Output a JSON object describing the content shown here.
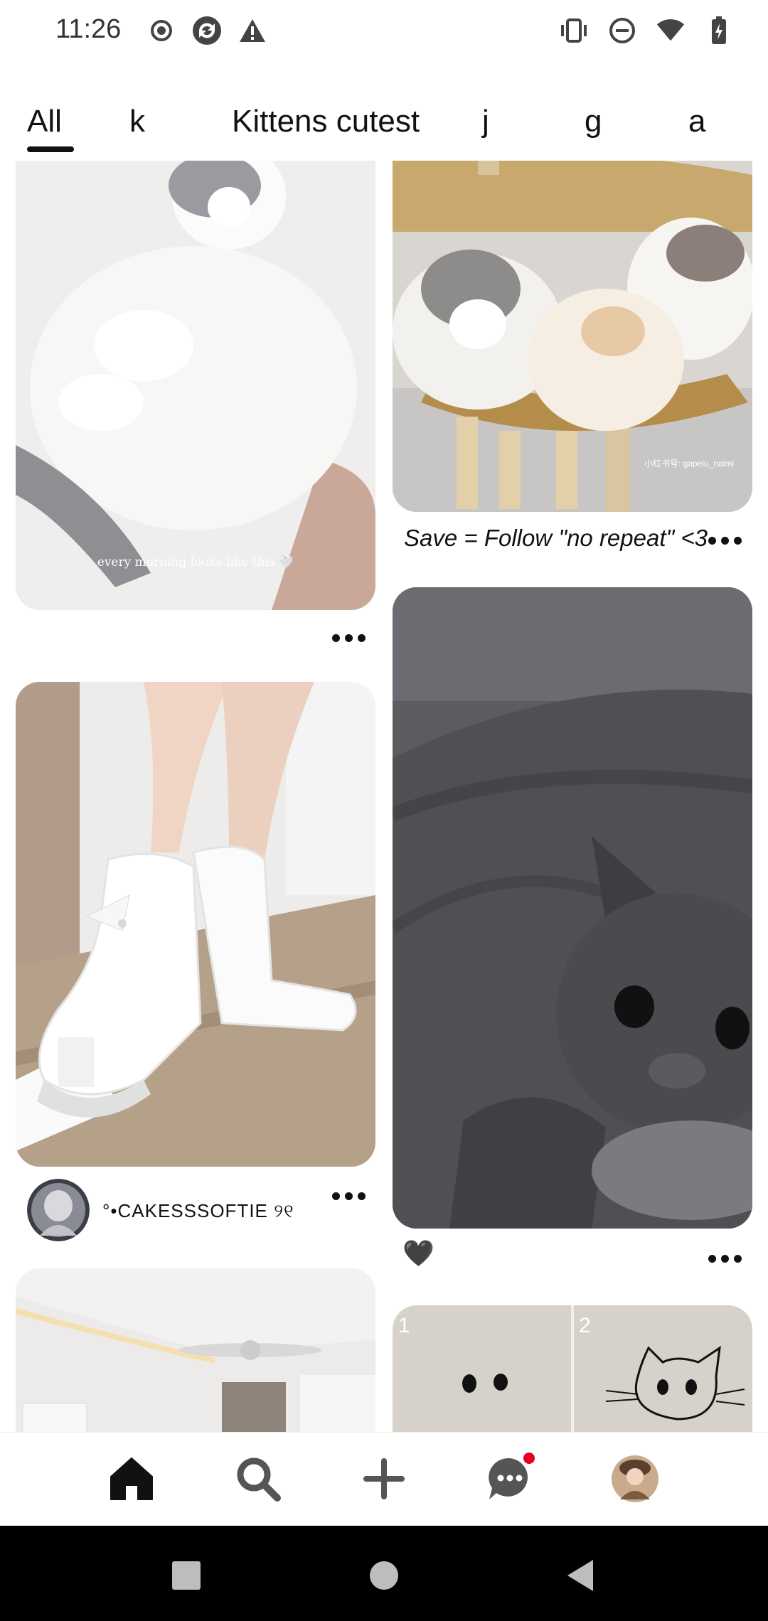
{
  "status_bar": {
    "time": "11:26",
    "left_icons": [
      "record-icon",
      "sync-app-icon",
      "warning-icon"
    ],
    "right_icons": [
      "vibrate-icon",
      "do-not-disturb-icon",
      "wifi-icon",
      "battery-icon"
    ]
  },
  "tabs": [
    {
      "label": "All",
      "selected": true
    },
    {
      "label": "k",
      "selected": false
    },
    {
      "label": "Kittens cutest",
      "selected": false
    },
    {
      "label": "j",
      "selected": false
    },
    {
      "label": "g",
      "selected": false
    },
    {
      "label": "a",
      "selected": false
    }
  ],
  "feed": {
    "pin1": {
      "image_overlay_text": "every morning looks like this 🤍"
    },
    "pin2": {
      "watermark": "小红书号: gapelu_naimi",
      "caption": "Save = Follow \"no repeat\" <3"
    },
    "pin3": {
      "creator_name": "°•CAKESSSOFTIE ୨୧"
    },
    "pin4": {
      "caption": "🖤"
    },
    "pin6": {
      "panel_numbers": [
        "1",
        "2"
      ]
    }
  },
  "bottom_nav": {
    "items": [
      "home-icon",
      "search-icon",
      "create-icon",
      "messages-icon",
      "profile-avatar"
    ],
    "active": "home-icon",
    "messages_badge_color": "#e60023"
  },
  "system_nav": [
    "recents-button",
    "home-button",
    "back-button"
  ]
}
